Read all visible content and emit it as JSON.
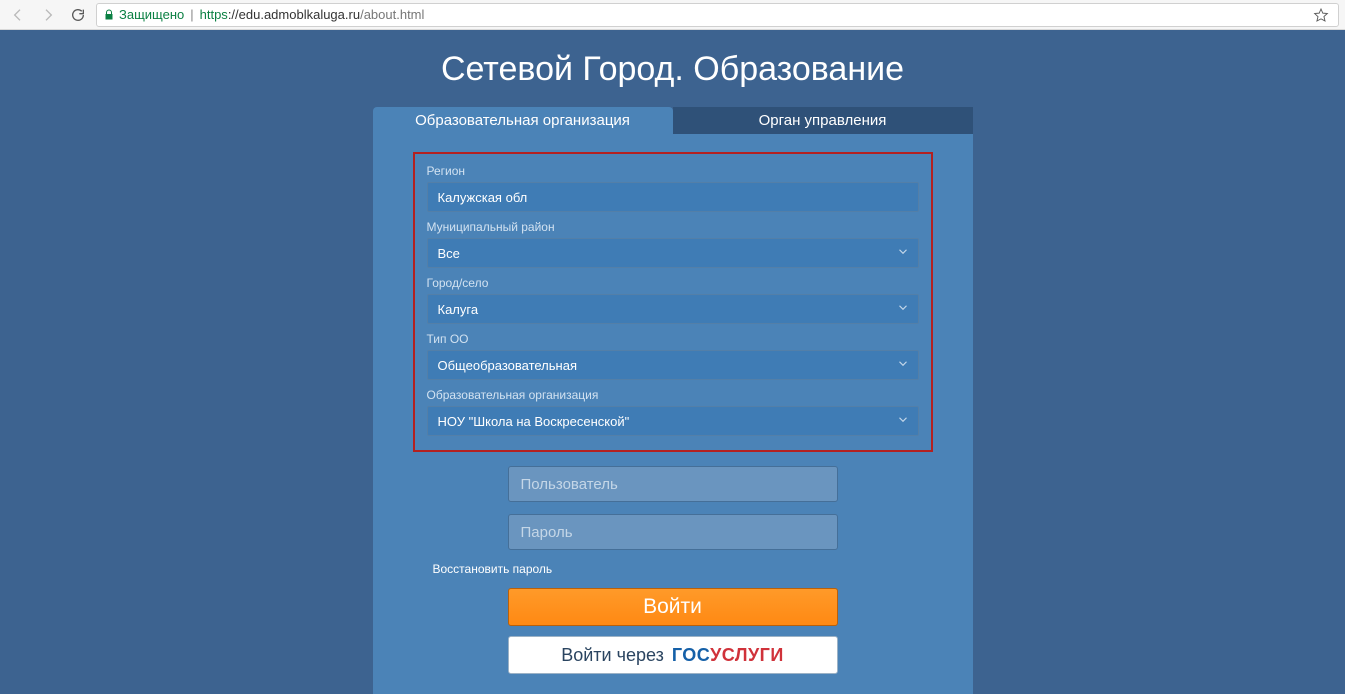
{
  "browser": {
    "secure_label": "Защищено",
    "url_scheme": "https",
    "url_host": "://edu.admoblkaluga.ru",
    "url_path": "/about.html"
  },
  "page_title": "Сетевой Город. Образование",
  "tabs": {
    "org": "Образовательная организация",
    "authority": "Орган управления"
  },
  "form": {
    "region_label": "Регион",
    "region_value": "Калужская обл",
    "district_label": "Муниципальный район",
    "district_value": "Все",
    "city_label": "Город/село",
    "city_value": "Калуга",
    "type_label": "Тип ОО",
    "type_value": "Общеобразовательная",
    "org_label": "Образовательная организация",
    "org_value": "НОУ \"Школа на Воскресенской\""
  },
  "creds": {
    "user_placeholder": "Пользователь",
    "pass_placeholder": "Пароль"
  },
  "links": {
    "restore": "Восстановить пароль"
  },
  "buttons": {
    "login": "Войти",
    "gos_prefix": "Войти через",
    "gos_blue": "ГОС",
    "gos_red": "УСЛУГИ"
  }
}
